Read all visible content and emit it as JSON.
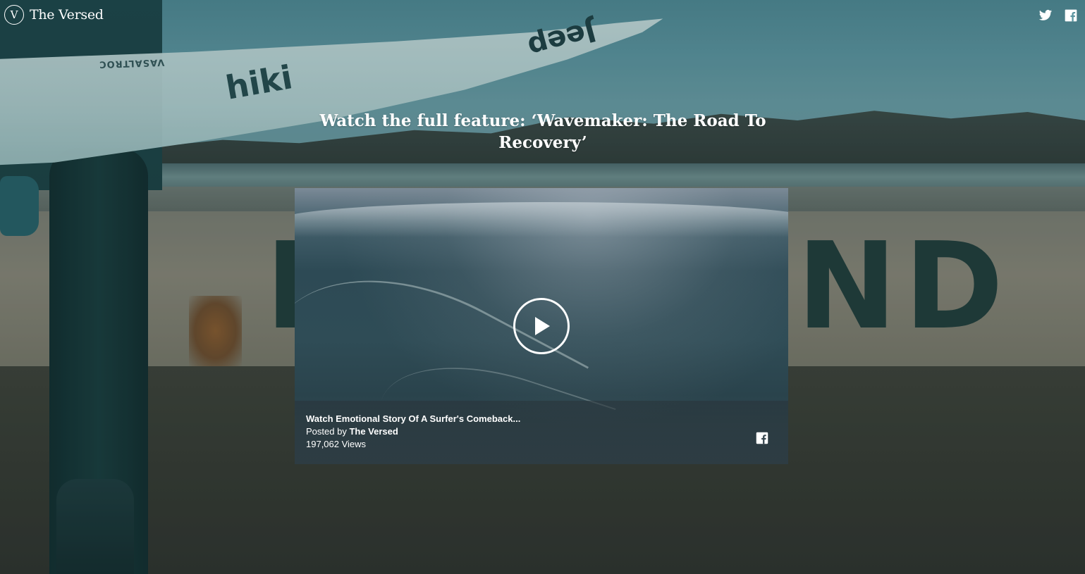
{
  "brand": {
    "logo_letter": "V",
    "name": "The Versed"
  },
  "header": {
    "social": [
      {
        "icon": "twitter-icon",
        "label": "Twitter"
      },
      {
        "icon": "facebook-icon",
        "label": "Facebook"
      }
    ]
  },
  "background": {
    "board_text": "Jeep",
    "board_scribble": "hiki",
    "board_small": "VASALTROC",
    "wall_letter_left": "D",
    "wall_letters_right": "ND"
  },
  "feature": {
    "headline": "Watch the full feature:  ‘Wavemaker: The Road To Recovery’"
  },
  "video": {
    "title": "Watch Emotional Story Of A Surfer's Comeback...",
    "posted_prefix": "Posted by",
    "posted_by": "The Versed",
    "views": "197,062 Views",
    "play_icon": "play-icon",
    "share_icon": "facebook-icon"
  },
  "colors": {
    "text": "#ffffff",
    "sky": "#5b95a0",
    "wetsuit": "#173b3b",
    "wall": "#8a8677"
  }
}
